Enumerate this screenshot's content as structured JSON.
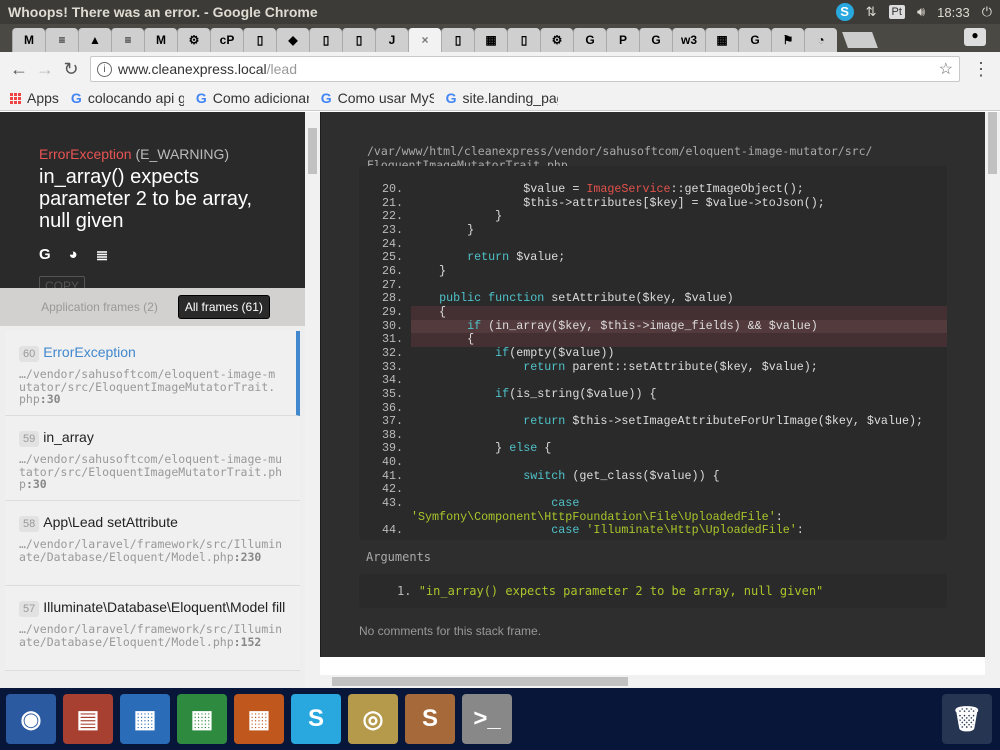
{
  "window": {
    "title": "Whoops! There was an error. - Google Chrome",
    "clock": "18:33",
    "keyboard": "Pt"
  },
  "tabs": [
    "M",
    "≡",
    "▲",
    "≡",
    "M",
    "⚙",
    "cP",
    "▯",
    "◆",
    "▯",
    "▯",
    "J",
    "×",
    "▯",
    "▦",
    "▯",
    "⚙",
    "G",
    "P",
    "G",
    "w3",
    "▦",
    "G",
    "⚑",
    "◔"
  ],
  "address": {
    "host": "www.cleanexpress.local",
    "path": "/lead"
  },
  "bookmarks": [
    {
      "label": "Apps"
    },
    {
      "label": "colocando api go"
    },
    {
      "label": "Como adicionar"
    },
    {
      "label": "Como usar MySQ"
    },
    {
      "label": "site.landing_pag"
    }
  ],
  "error": {
    "class": "ErrorException",
    "type": "(E_WARNING)",
    "message": "in_array() expects parameter 2 to be array, null given",
    "copy": "COPY"
  },
  "frame_tabs": {
    "app": "Application frames (2)",
    "all": "All frames (61)"
  },
  "frames": [
    {
      "num": "60",
      "name": "ErrorException",
      "path": "…/vendor/sahusoftcom/eloquent-image-mutator/src/EloquentImageMutatorTrait.php",
      "line": ":30",
      "active": true
    },
    {
      "num": "59",
      "name": "in_array",
      "path": "…/vendor/sahusoftcom/eloquent-image-mutator/src/EloquentImageMutatorTrait.php",
      "line": ":30"
    },
    {
      "num": "58",
      "name": "App\\Lead setAttribute",
      "path": "…/vendor/laravel/framework/src/Illuminate/Database/Eloquent/Model.php",
      "line": ":230"
    },
    {
      "num": "57",
      "name": "Illuminate\\Database\\Eloquent\\Model fill",
      "path": "…/vendor/laravel/framework/src/Illuminate/Database/Eloquent/Model.php",
      "line": ":152"
    }
  ],
  "file": {
    "dir": "/var/www/html/cleanexpress/vendor/sahusoftcom/eloquent-image-mutator/src/",
    "name": "EloquentImageMutatorTrait.php"
  },
  "code": [
    {
      "n": "20.",
      "t": [
        [
          "                $value = ",
          ""
        ],
        [
          "ImageService",
          "cls2"
        ],
        [
          "::getImageObject();",
          ""
        ]
      ]
    },
    {
      "n": "21.",
      "t": [
        [
          "                $this->attributes[$key] = $value->toJson();",
          ""
        ]
      ]
    },
    {
      "n": "22.",
      "t": [
        [
          "            }",
          ""
        ]
      ]
    },
    {
      "n": "23.",
      "t": [
        [
          "        }",
          ""
        ]
      ]
    },
    {
      "n": "24.",
      "t": []
    },
    {
      "n": "25.",
      "t": [
        [
          "        ",
          ""
        ],
        [
          "return",
          "kw"
        ],
        [
          " $value;",
          ""
        ]
      ]
    },
    {
      "n": "26.",
      "t": [
        [
          "    }",
          ""
        ]
      ]
    },
    {
      "n": "27.",
      "t": []
    },
    {
      "n": "28.",
      "t": [
        [
          "    ",
          ""
        ],
        [
          "public function",
          "kw"
        ],
        [
          " setAttribute($key, $value)",
          ""
        ]
      ]
    },
    {
      "n": "29.",
      "h": "hl",
      "t": [
        [
          "    {",
          ""
        ]
      ]
    },
    {
      "n": "30.",
      "h": "cur",
      "t": [
        [
          "        ",
          ""
        ],
        [
          "if",
          "kw"
        ],
        [
          " (in_array($key, $this->image_fields) && $value)",
          ""
        ]
      ]
    },
    {
      "n": "31.",
      "h": "hl",
      "t": [
        [
          "        {",
          ""
        ]
      ]
    },
    {
      "n": "32.",
      "t": [
        [
          "            ",
          ""
        ],
        [
          "if",
          "kw"
        ],
        [
          "(empty($value))",
          ""
        ]
      ]
    },
    {
      "n": "33.",
      "t": [
        [
          "                ",
          ""
        ],
        [
          "return",
          "kw"
        ],
        [
          " parent::setAttribute($key, $value);",
          ""
        ]
      ]
    },
    {
      "n": "34.",
      "t": []
    },
    {
      "n": "35.",
      "t": [
        [
          "            ",
          ""
        ],
        [
          "if",
          "kw"
        ],
        [
          "(is_string($value)) {",
          ""
        ]
      ]
    },
    {
      "n": "36.",
      "t": []
    },
    {
      "n": "37.",
      "t": [
        [
          "                ",
          ""
        ],
        [
          "return",
          "kw"
        ],
        [
          " $this->setImageAttributeForUrlImage($key, $value);",
          ""
        ]
      ]
    },
    {
      "n": "38.",
      "t": []
    },
    {
      "n": "39.",
      "t": [
        [
          "            } ",
          ""
        ],
        [
          "else",
          "kw"
        ],
        [
          " {",
          ""
        ]
      ]
    },
    {
      "n": "40.",
      "t": []
    },
    {
      "n": "41.",
      "t": [
        [
          "                ",
          ""
        ],
        [
          "switch",
          "kw"
        ],
        [
          " (get_class($value)) {",
          ""
        ]
      ]
    },
    {
      "n": "42.",
      "t": []
    },
    {
      "n": "43.",
      "t": [
        [
          "                    ",
          ""
        ],
        [
          "case",
          "kw"
        ]
      ]
    },
    {
      "n": "",
      "t": [
        [
          "'Symfony\\Component\\HttpFoundation\\File\\UploadedFile'",
          "str"
        ],
        [
          ":",
          ""
        ]
      ]
    },
    {
      "n": "44.",
      "t": [
        [
          "                    ",
          ""
        ],
        [
          "case",
          "kw"
        ],
        [
          " ",
          ""
        ],
        [
          "'Illuminate\\Http\\UploadedFile'",
          "str"
        ],
        [
          ":",
          ""
        ]
      ]
    }
  ],
  "arguments": {
    "label": "Arguments",
    "items": [
      {
        "n": "1.",
        "value": "\"in_array() expects parameter 2 to be array, null given\""
      }
    ]
  },
  "comments": "No comments for this stack frame.",
  "dock": [
    {
      "icon": "ubuntu-icon",
      "bg": "#2c5aa0",
      "g": "◉"
    },
    {
      "icon": "files-icon",
      "bg": "#a84032",
      "g": "▤"
    },
    {
      "icon": "writer-icon",
      "bg": "#2a6cb8",
      "g": "▦"
    },
    {
      "icon": "calc-icon",
      "bg": "#2d8a3e",
      "g": "▦"
    },
    {
      "icon": "impress-icon",
      "bg": "#c0581d",
      "g": "▦"
    },
    {
      "icon": "skype-icon",
      "bg": "#29a8e0",
      "g": "S"
    },
    {
      "icon": "chrome-icon",
      "bg": "#b49a4a",
      "g": "◎"
    },
    {
      "icon": "sublime-icon",
      "bg": "#a66a3a",
      "g": "S"
    },
    {
      "icon": "terminal-icon",
      "bg": "#888",
      "g": ">_"
    }
  ]
}
